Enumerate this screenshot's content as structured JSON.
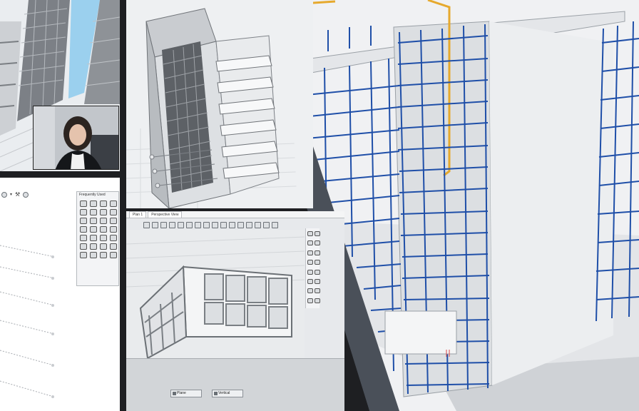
{
  "panels": {
    "bottom_center": {
      "tabs": [
        "Plan 1",
        "Perspective View"
      ],
      "buttons": [
        "Plane",
        "Vertical"
      ]
    },
    "bottom_left": {
      "palette_title": "Frequently Used"
    }
  },
  "icons": {
    "toolbar": [
      "globe-icon",
      "dropdown-icon",
      "wrench-icon",
      "settings-icon"
    ]
  },
  "colors": {
    "rebar": "#1f4fa8",
    "duct": "#e6a92d",
    "divider": "#4a5059",
    "concrete": "#ebedef"
  }
}
